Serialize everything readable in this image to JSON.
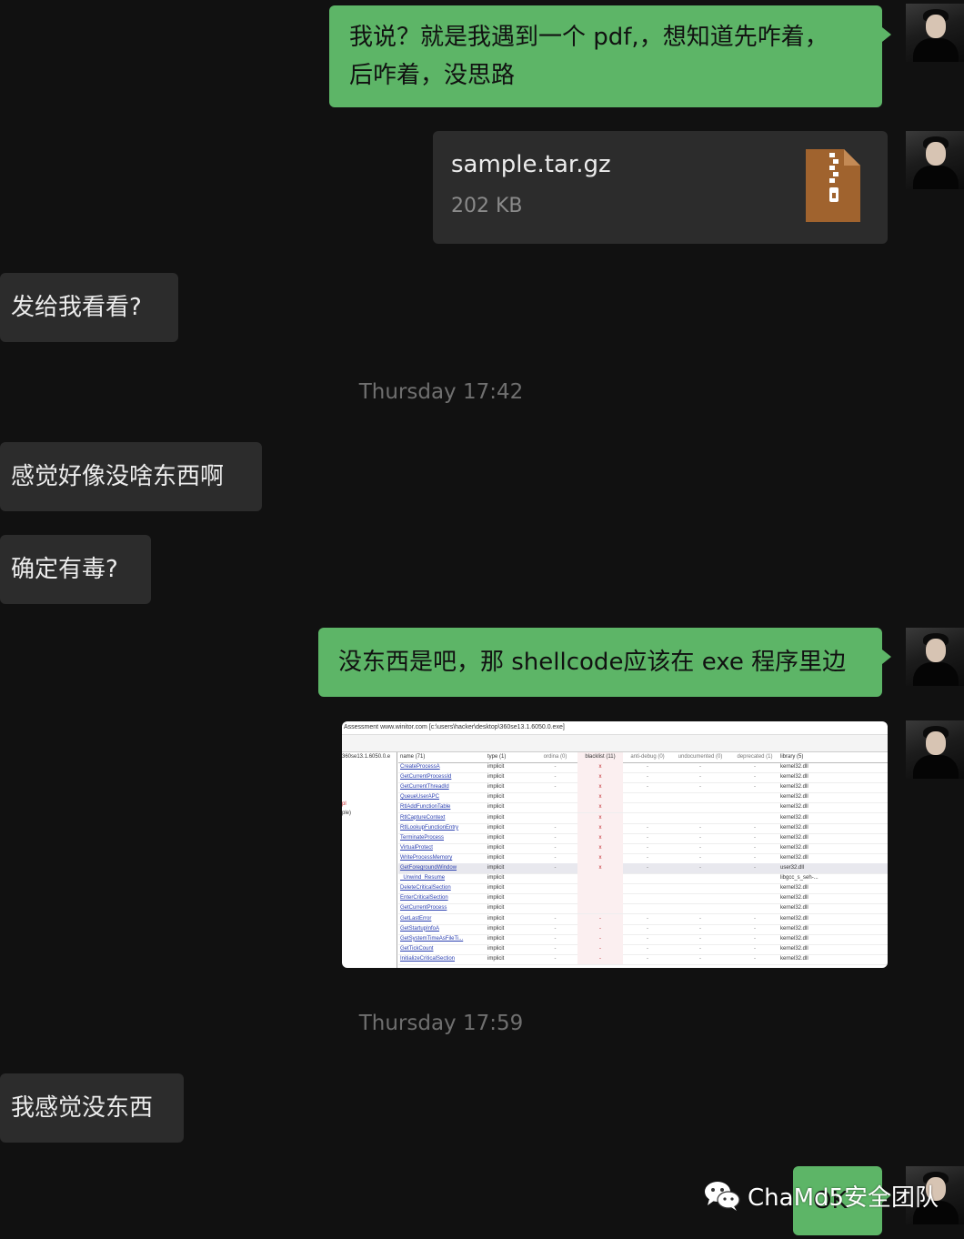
{
  "messages": {
    "m1": "我说？就是我遇到一个 pdf,，想知道先咋着，",
    "m1b": "后咋着，没思路",
    "file": {
      "name": "sample.tar.gz",
      "size": "202 KB"
    },
    "m2": "发给我看看?",
    "ts1": "Thursday 17:42",
    "m3": "感觉好像没啥东西啊",
    "m4": "确定有毒?",
    "m5": "没东西是吧，那 shellcode应该在 exe 程序里边",
    "ts2": "Thursday 17:59",
    "m6": "我感觉没东西",
    "m7": "OK"
  },
  "screenshot": {
    "title": "Assessment    www.winitor.com [c:\\users\\hacker\\desktop\\360se13.1.6050.0.exe]",
    "left_items": [
      "360se13.1.6050.0.e",
      "pl",
      "ple)"
    ],
    "headers": {
      "name": "name (71)",
      "type": "type (1)",
      "ordinal": "ordina (0)",
      "blacklist": "blacklist (11)",
      "anti_debug": "anti-debug (0)",
      "undocumented": "undocumented (0)",
      "deprecated": "deprecated (1)",
      "library": "library (5)"
    },
    "rows": [
      {
        "name": "CreateProcessA",
        "type": "implicit",
        "ord": "-",
        "bl": "x",
        "ad": "-",
        "un": "-",
        "dep": "-",
        "lib": "kernel32.dll"
      },
      {
        "name": "GetCurrentProcessId",
        "type": "implicit",
        "ord": "-",
        "bl": "x",
        "ad": "-",
        "un": "-",
        "dep": "-",
        "lib": "kernel32.dll"
      },
      {
        "name": "GetCurrentThreadId",
        "type": "implicit",
        "ord": "-",
        "bl": "x",
        "ad": "-",
        "un": "-",
        "dep": "-",
        "lib": "kernel32.dll"
      },
      {
        "name": "QueueUserAPC",
        "type": "implicit",
        "ord": "",
        "bl": "x",
        "ad": "",
        "un": "",
        "dep": "",
        "lib": "kernel32.dll"
      },
      {
        "name": "RtlAddFunctionTable",
        "type": "implicit",
        "ord": "",
        "bl": "x",
        "ad": "",
        "un": "",
        "dep": "",
        "lib": "kernel32.dll"
      },
      {
        "name": "RtlCaptureContext",
        "type": "implicit",
        "ord": "",
        "bl": "x",
        "ad": "",
        "un": "",
        "dep": "",
        "lib": "kernel32.dll"
      },
      {
        "name": "RtlLookupFunctionEntry",
        "type": "implicit",
        "ord": "-",
        "bl": "x",
        "ad": "-",
        "un": "-",
        "dep": "-",
        "lib": "kernel32.dll"
      },
      {
        "name": "TerminateProcess",
        "type": "implicit",
        "ord": "-",
        "bl": "x",
        "ad": "-",
        "un": "-",
        "dep": "-",
        "lib": "kernel32.dll"
      },
      {
        "name": "VirtualProtect",
        "type": "implicit",
        "ord": "-",
        "bl": "x",
        "ad": "-",
        "un": "-",
        "dep": "-",
        "lib": "kernel32.dll"
      },
      {
        "name": "WriteProcessMemory",
        "type": "implicit",
        "ord": "-",
        "bl": "x",
        "ad": "-",
        "un": "-",
        "dep": "-",
        "lib": "kernel32.dll"
      },
      {
        "name": "GetForegroundWindow",
        "type": "implicit",
        "ord": "-",
        "bl": "x",
        "ad": "-",
        "un": "-",
        "dep": "-",
        "lib": "user32.dll"
      },
      {
        "name": "_Unwind_Resume",
        "type": "implicit",
        "ord": "",
        "bl": "",
        "ad": "",
        "un": "",
        "dep": "",
        "lib": "libgcc_s_seh-..."
      },
      {
        "name": "DeleteCriticalSection",
        "type": "implicit",
        "ord": "",
        "bl": "",
        "ad": "",
        "un": "",
        "dep": "",
        "lib": "kernel32.dll"
      },
      {
        "name": "EnterCriticalSection",
        "type": "implicit",
        "ord": "",
        "bl": "",
        "ad": "",
        "un": "",
        "dep": "",
        "lib": "kernel32.dll"
      },
      {
        "name": "GetCurrentProcess",
        "type": "implicit",
        "ord": "",
        "bl": "",
        "ad": "",
        "un": "",
        "dep": "",
        "lib": "kernel32.dll"
      },
      {
        "name": "GetLastError",
        "type": "implicit",
        "ord": "-",
        "bl": "-",
        "ad": "-",
        "un": "-",
        "dep": "-",
        "lib": "kernel32.dll"
      },
      {
        "name": "GetStartupInfoA",
        "type": "implicit",
        "ord": "-",
        "bl": "-",
        "ad": "-",
        "un": "-",
        "dep": "-",
        "lib": "kernel32.dll"
      },
      {
        "name": "GetSystemTimeAsFileTi...",
        "type": "implicit",
        "ord": "-",
        "bl": "-",
        "ad": "-",
        "un": "-",
        "dep": "-",
        "lib": "kernel32.dll"
      },
      {
        "name": "GetTickCount",
        "type": "implicit",
        "ord": "-",
        "bl": "-",
        "ad": "-",
        "un": "-",
        "dep": "-",
        "lib": "kernel32.dll"
      },
      {
        "name": "InitializeCriticalSection",
        "type": "implicit",
        "ord": "-",
        "bl": "-",
        "ad": "-",
        "un": "-",
        "dep": "-",
        "lib": "kernel32.dll"
      }
    ]
  },
  "watermark": "ChaMd5安全团队",
  "colors": {
    "outgoing": "#5db567",
    "incoming": "#2c2c2c",
    "background": "#111111"
  }
}
